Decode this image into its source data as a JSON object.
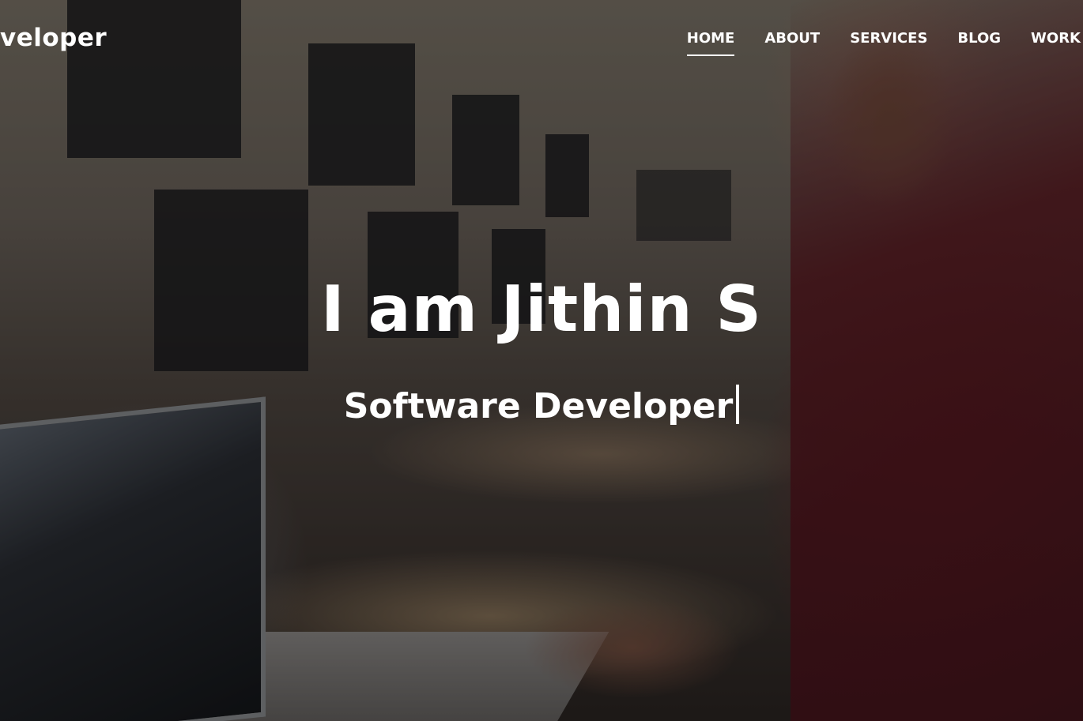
{
  "brand": {
    "text": "veloper"
  },
  "nav": {
    "items": [
      {
        "label": "HOME"
      },
      {
        "label": "ABOUT"
      },
      {
        "label": "SERVICES"
      },
      {
        "label": "BLOG"
      },
      {
        "label": "WORK"
      }
    ]
  },
  "hero": {
    "title": "I am Jithin S",
    "subtitle": "Software Developer"
  }
}
